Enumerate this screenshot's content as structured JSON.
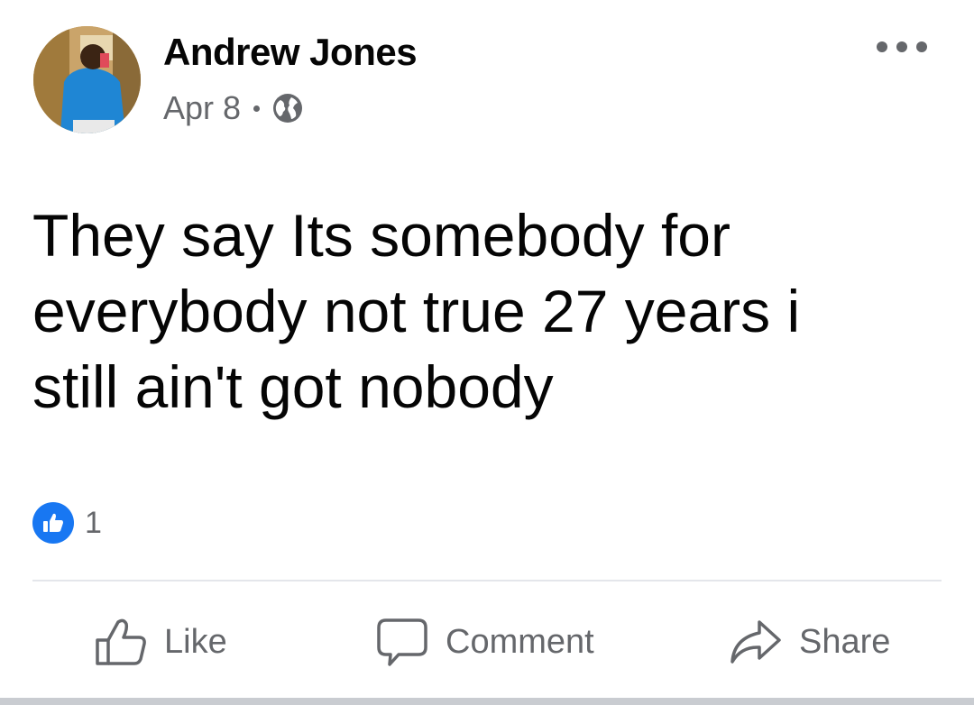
{
  "post": {
    "author": "Andrew Jones",
    "date": "Apr 8",
    "privacy_icon": "globe-icon",
    "text": "They say Its somebody for everybody not true 27 years i still ain't got nobody",
    "reaction_count": "1",
    "reaction_icon": "like-reaction-icon"
  },
  "actions": {
    "like": "Like",
    "comment": "Comment",
    "share": "Share"
  },
  "colors": {
    "accent": "#1877f2",
    "secondary_text": "#65676b",
    "primary_text": "#050505",
    "divider": "#e4e6eb"
  }
}
